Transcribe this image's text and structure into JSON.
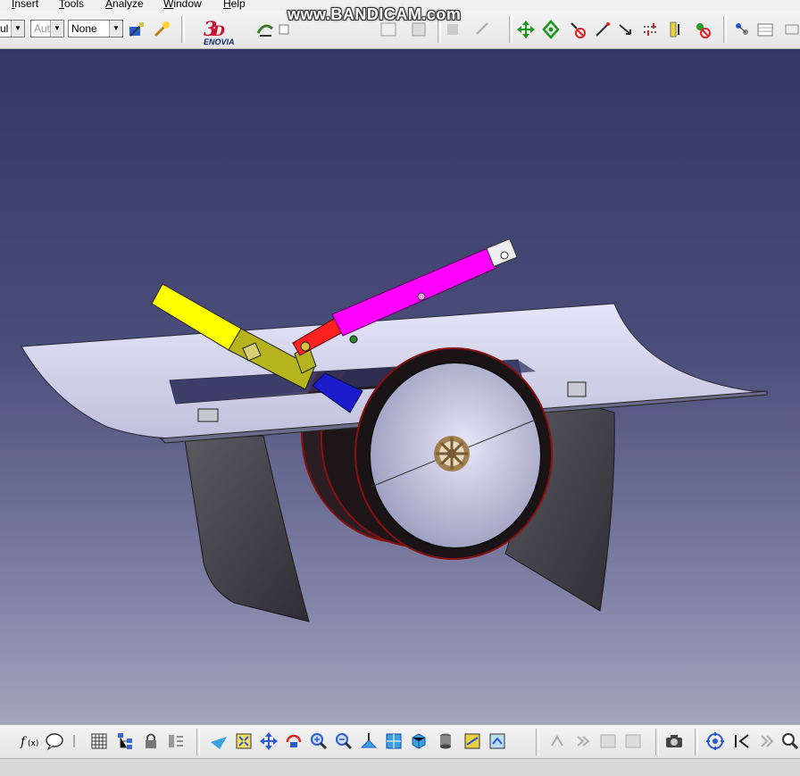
{
  "menu": {
    "items": [
      "Insert",
      "Tools",
      "Analyze",
      "Window",
      "Help"
    ]
  },
  "toolbar": {
    "style_combo_value": "ul",
    "line_combo_value": "Aut",
    "layer_combo_value": "None",
    "enovia_label": "ENOVIA",
    "icons": [
      "format-painter-icon",
      "magic-wand-icon",
      "enovia-3d-logo-icon",
      "catalog-icon",
      "checkbox-icon",
      "view-icon",
      "compass-icon",
      "manipulate-icon",
      "rotate-icon",
      "fix-icon",
      "snap-icon",
      "measure-icon",
      "axis-icon",
      "constraint-icon",
      "hide-icon",
      "properties-icon",
      "graph-icon",
      "more-icon"
    ]
  },
  "watermark": {
    "text": "www.BANDICAM.com"
  },
  "bottom_toolbar": {
    "icons": [
      "formula-icon",
      "comment-icon",
      "grid-icon",
      "tree-icon",
      "lock-icon",
      "explode-icon",
      "fly-icon",
      "fit-all-icon",
      "pan-icon",
      "rotate-view-icon",
      "zoom-in-icon",
      "zoom-out-icon",
      "normal-view-icon",
      "iso-view-icon",
      "shading-icon",
      "hide-show-icon",
      "swap-icon",
      "render-icon",
      "capture-icon",
      "target-icon",
      "first-icon",
      "last-icon",
      "measure-icon"
    ]
  },
  "colors": {
    "viewport_top": "#353763",
    "viewport_bottom": "#a3a5bd",
    "yellow_link": "#ffff00",
    "olive_link": "#b5b31e",
    "magenta_cylinder": "#ff00ff",
    "red_rod": "#ff2020",
    "blue_block": "#1c1ccc",
    "wheel_rim": "#1a1416",
    "wheel_disc": "#b8b9d6",
    "platform": "#d6d7ee",
    "skid": "#4a4a4e"
  }
}
